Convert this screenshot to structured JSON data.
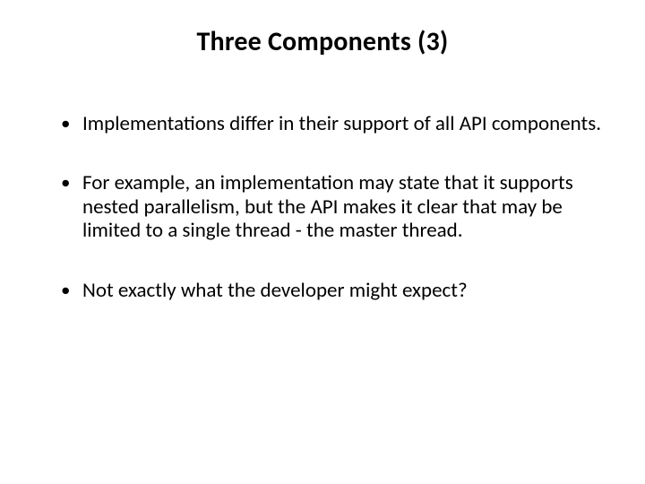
{
  "slide": {
    "title": "Three Components  (3)",
    "bullets": [
      "Implementations differ in their support of all API components.",
      "For example, an implementation may state that it supports nested parallelism, but the API makes it clear that may be limited to a single thread - the master thread.",
      "Not exactly what the developer might expect?"
    ]
  }
}
